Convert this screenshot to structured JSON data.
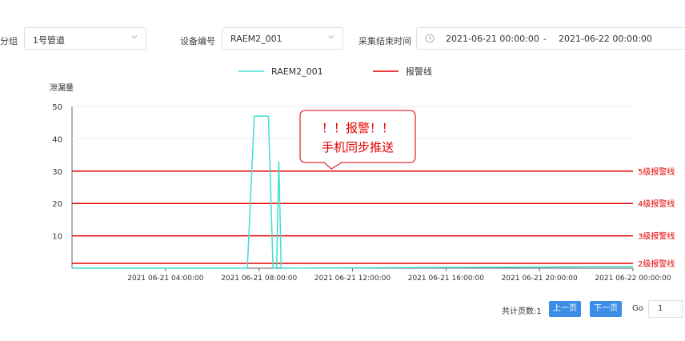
{
  "filters": {
    "group_label": "分组",
    "group_value": "1号管道",
    "device_label": "设备编号",
    "device_value": "RAEM2_001",
    "end_time_label": "采集结束时间",
    "start_date": "2021-06-21 00:00:00",
    "range_sep": "-",
    "end_date": "2021-06-22 00:00:00"
  },
  "legend": {
    "series_name": "RAEM2_001",
    "alarm_name": "报警线"
  },
  "callout": {
    "line1": "！！报警！！",
    "line2": "手机同步推送"
  },
  "colors": {
    "series": "#40e0d0",
    "alarm": "#e60000",
    "callout_border": "#e03030",
    "button": "#3b8de6"
  },
  "chart_data": {
    "type": "line",
    "ylabel": "泄漏量",
    "ylim": [
      0,
      50
    ],
    "yticks": [
      10,
      20,
      30,
      40,
      50
    ],
    "xlim_hours": [
      0,
      24
    ],
    "xticks": [
      {
        "h": 4,
        "label": "2021 06-21 04:00:00"
      },
      {
        "h": 8,
        "label": "2021 06-21 08:00:00"
      },
      {
        "h": 12,
        "label": "2021 06-21 12:00:00"
      },
      {
        "h": 16,
        "label": "2021 06-21 16:00:00"
      },
      {
        "h": 20,
        "label": "2021 06-21 20:00:00"
      },
      {
        "h": 24,
        "label": "2021 06-22 00:00:00"
      }
    ],
    "series": [
      {
        "name": "RAEM2_001",
        "points": [
          [
            0,
            0
          ],
          [
            7.5,
            0
          ],
          [
            7.8,
            47
          ],
          [
            8.4,
            47
          ],
          [
            8.6,
            0
          ],
          [
            8.75,
            0
          ],
          [
            8.85,
            33
          ],
          [
            8.95,
            0
          ],
          [
            24,
            0.5
          ]
        ]
      }
    ],
    "alarm_lines": [
      {
        "value": 30,
        "label": "5级报警线"
      },
      {
        "value": 20,
        "label": "4级报警线"
      },
      {
        "value": 10,
        "label": "3级报警线"
      },
      {
        "value": 1.5,
        "label": "2级报警线"
      }
    ]
  },
  "pager": {
    "total_label": "共计页数:1",
    "prev_label": "上一页",
    "next_label": "下一页",
    "go_label": "Go",
    "page_value": "1"
  }
}
